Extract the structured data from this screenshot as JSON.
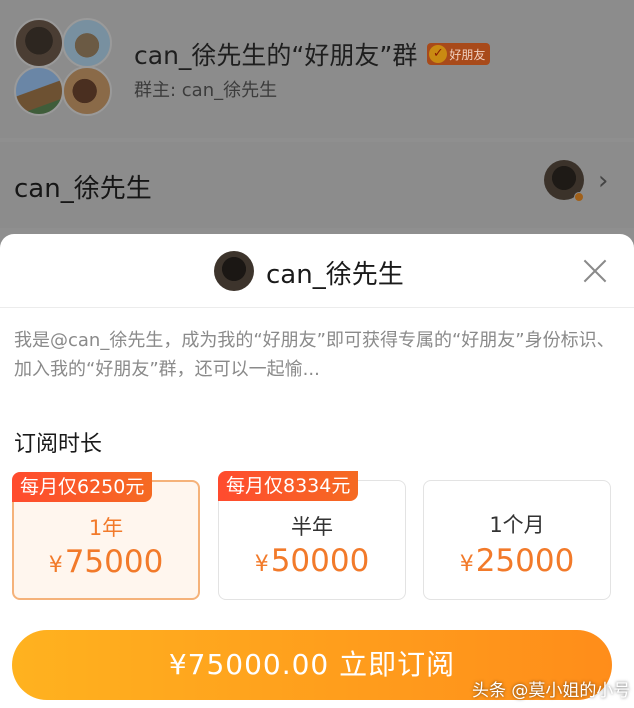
{
  "group": {
    "title": "can_徐先生的“好朋友”群",
    "badge_label": "好朋友",
    "owner_line": "群主: can_徐先生"
  },
  "member": {
    "name": "can_徐先生",
    "chevron": "›"
  },
  "sheet": {
    "title": "can_徐先生",
    "description": "我是@can_徐先生，成为我的“好朋友”即可获得专属的“好朋友”身份标识、加入我的“好朋友”群，还可以一起愉...",
    "section_title": "订阅时长",
    "plans": [
      {
        "badge": "每月仅6250元",
        "duration": "1年",
        "currency": "¥",
        "price": "75000",
        "selected": true
      },
      {
        "badge": "每月仅8334元",
        "duration": "半年",
        "currency": "¥",
        "price": "50000",
        "selected": false
      },
      {
        "badge": "",
        "duration": "1个月",
        "currency": "¥",
        "price": "25000",
        "selected": false
      }
    ],
    "subscribe_label": "¥75000.00 立即订阅"
  },
  "watermark": "头条 @莫小姐的小号",
  "colors": {
    "accent": "#f27a2a",
    "badge_red": "#ff4b2e",
    "button_start": "#ffb21f",
    "button_end": "#ff8d1a"
  },
  "icons": {
    "close": "close-icon",
    "chevron": "chevron-right-icon"
  }
}
